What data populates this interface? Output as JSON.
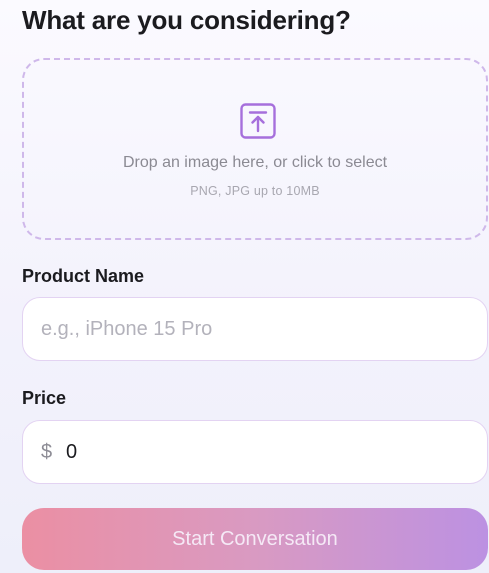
{
  "page": {
    "title": "What are you considering?"
  },
  "dropzone": {
    "text": "Drop an image here, or click to select",
    "hint": "PNG, JPG up to 10MB",
    "icon": "upload-icon"
  },
  "product_name": {
    "label": "Product Name",
    "placeholder": "e.g., iPhone 15 Pro",
    "value": ""
  },
  "price": {
    "label": "Price",
    "currency_symbol": "$",
    "value": "0"
  },
  "submit": {
    "label": "Start Conversation"
  },
  "colors": {
    "accent": "#9b6bd6",
    "dropzone_border": "#cfb8ea",
    "button_gradient_start": "#eb8fa3",
    "button_gradient_end": "#bc91e2"
  }
}
